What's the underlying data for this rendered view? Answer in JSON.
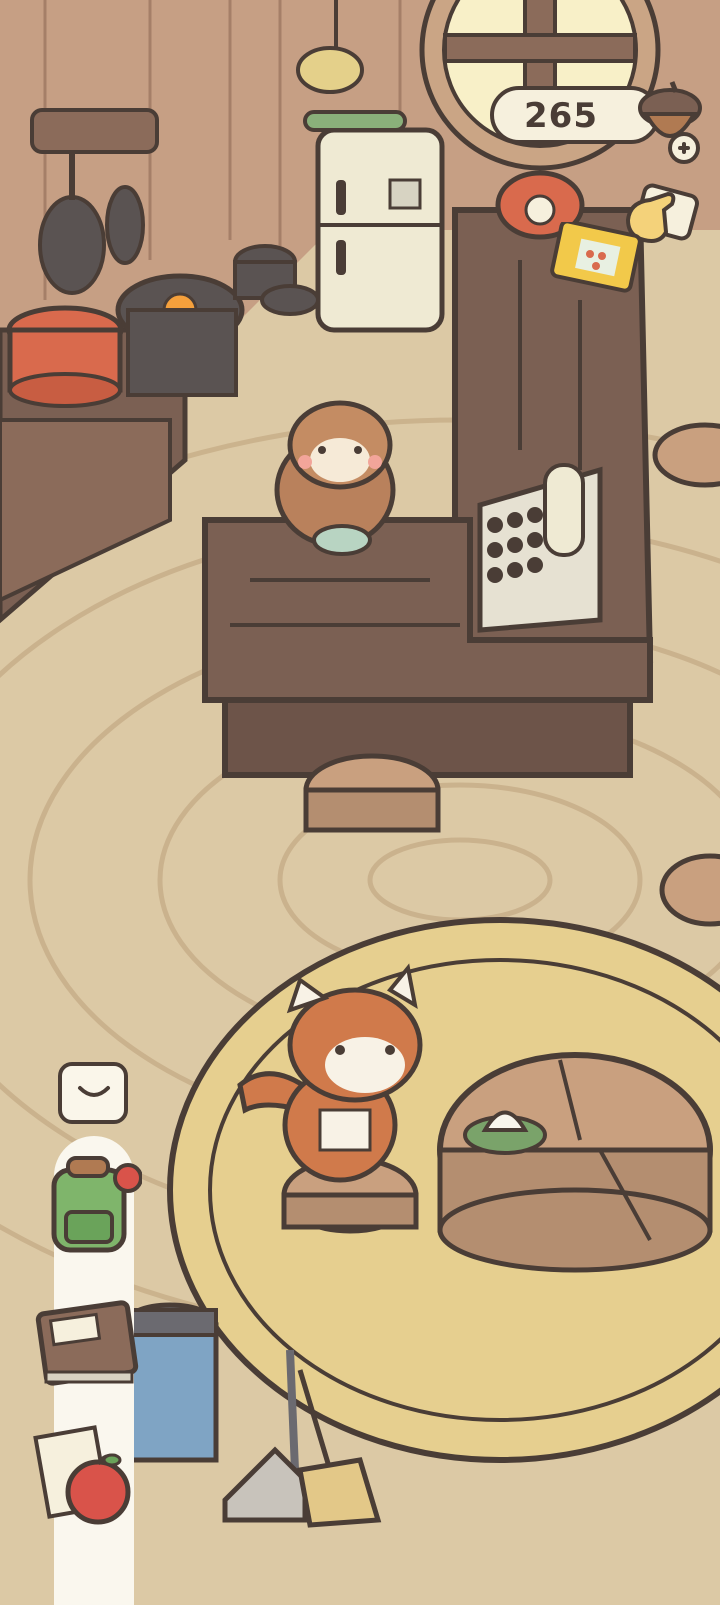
{
  "hud": {
    "acorn_count": "265",
    "currency_icon": "acorn-icon",
    "add_currency_icon": "plus-icon",
    "help_icon": "pointing-hand-icon",
    "mail_icon": "mail-icon"
  },
  "toolbar": {
    "collapse_icon": "chevron-down-icon",
    "items": [
      {
        "icon": "backpack-icon"
      },
      {
        "icon": "recipe-book-icon"
      },
      {
        "icon": "apple-icon"
      }
    ]
  },
  "colors": {
    "outline": "#4a3d36",
    "floor": "#dcc9a5",
    "rug": "#e6cf8f",
    "wood_dark": "#8b6b5a",
    "panel": "#f6f0dd"
  }
}
